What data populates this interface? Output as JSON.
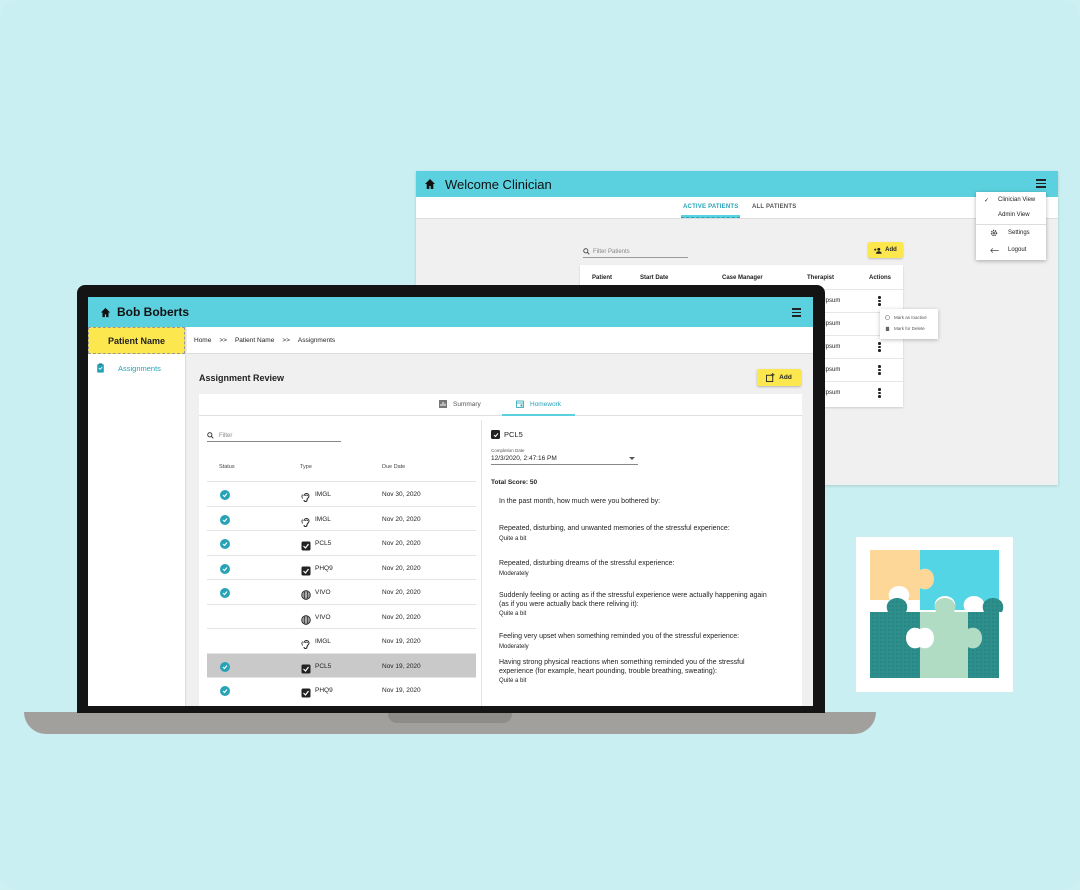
{
  "clinician_window": {
    "title": "Welcome Clinician",
    "tabs": [
      "ACTIVE PATIENTS",
      "ALL PATIENTS"
    ],
    "filter_placeholder": "Filter Patients",
    "add_label": "Add",
    "table_headers": [
      "Patient",
      "Start Date",
      "Case Manager",
      "Therapist",
      "Actions"
    ],
    "therapist_values": [
      "Ipsum",
      "Ipsum",
      "Ipsum",
      "Ipsum",
      "Ipsum"
    ],
    "row_menu": [
      "Mark as Inactive",
      "Mark for Delete"
    ],
    "dropdown": {
      "items": [
        "Clinician View",
        "Admin View",
        "Settings",
        "Logout"
      ]
    }
  },
  "app": {
    "user_name": "Bob Boberts",
    "patient_name": "Patient Name",
    "sidebar_item": "Assignments",
    "breadcrumb": [
      "Home",
      ">>",
      "Patient Name",
      ">>",
      "Assignments"
    ],
    "page_title": "Assignment Review",
    "add_label": "Add",
    "tabs": [
      "Summary",
      "Homework"
    ],
    "filter_placeholder": "Filter",
    "list_headers": [
      "Status",
      "Type",
      "Due Date"
    ],
    "rows": [
      {
        "done": true,
        "icon": "ear-icon",
        "type": "IMGL",
        "date": "Nov 30, 2020",
        "selected": false
      },
      {
        "done": true,
        "icon": "ear-icon",
        "type": "IMGL",
        "date": "Nov 20, 2020",
        "selected": false
      },
      {
        "done": true,
        "icon": "checkbox-icon",
        "type": "PCL5",
        "date": "Nov 20, 2020",
        "selected": false
      },
      {
        "done": true,
        "icon": "checkbox-icon",
        "type": "PHQ9",
        "date": "Nov 20, 2020",
        "selected": false
      },
      {
        "done": true,
        "icon": "globe-icon",
        "type": "VIVO",
        "date": "Nov 20, 2020",
        "selected": false
      },
      {
        "done": false,
        "icon": "globe-icon",
        "type": "VIVO",
        "date": "Nov 20, 2020",
        "selected": false
      },
      {
        "done": false,
        "icon": "ear-icon",
        "type": "IMGL",
        "date": "Nov 19, 2020",
        "selected": false
      },
      {
        "done": true,
        "icon": "checkbox-icon",
        "type": "PCL5",
        "date": "Nov 19, 2020",
        "selected": true
      },
      {
        "done": true,
        "icon": "checkbox-icon",
        "type": "PHQ9",
        "date": "Nov 19, 2020",
        "selected": false
      }
    ],
    "detail": {
      "title": "PCL5",
      "completion_label": "Completion Date",
      "completion_value": "12/3/2020, 2:47:16 PM",
      "total_score": "Total Score: 50",
      "intro": "In the past month, how much were you bothered by:",
      "questions": [
        {
          "q": "Repeated, disturbing, and unwanted memories of the stressful experience:",
          "a": "Quite a bit"
        },
        {
          "q": "Repeated, disturbing dreams of the stressful experience:",
          "a": "Moderately"
        },
        {
          "q": "Suddenly feeling or acting as if the stressful experience were actually happening again (as if you were actually back there reliving it):",
          "a": "Quite a bit"
        },
        {
          "q": "Feeling very upset when something reminded you of the stressful experience:",
          "a": "Moderately"
        },
        {
          "q": "Having strong physical reactions when something reminded you of the stressful experience (for example, heart pounding, trouble breathing, sweating):",
          "a": "Quite a bit"
        }
      ]
    }
  },
  "colors": {
    "accent": "#5bd0df",
    "accent_dark": "#26a3b7",
    "yellow": "#fde74f"
  }
}
